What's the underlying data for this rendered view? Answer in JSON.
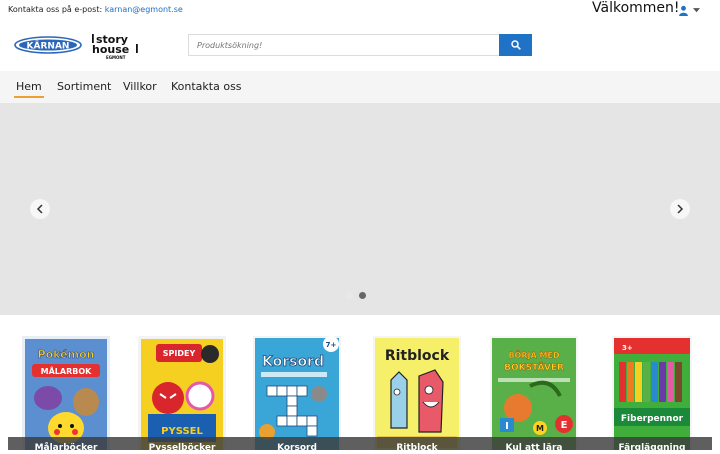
{
  "topbar": {
    "contact_prefix": "Kontakta oss på e-post:",
    "contact_email": "karnan@egmont.se",
    "welcome": "Välkommen!"
  },
  "header": {
    "logo_karnan": "KÄRNAN",
    "logo_story_line1": "story",
    "logo_story_line2": "house",
    "logo_story_sub": "EGMONT",
    "search_placeholder": "Produktsökning!"
  },
  "nav": {
    "items": [
      {
        "label": "Hem",
        "active": true
      },
      {
        "label": "Sortiment",
        "active": false
      },
      {
        "label": "Villkor",
        "active": false
      },
      {
        "label": "Kontakta oss",
        "active": false
      }
    ]
  },
  "hero": {
    "slides": 2,
    "active_slide": 2
  },
  "products": [
    {
      "label": "Målarböcker",
      "cover_title": "MÅLARBOK",
      "cover_brand": "Pokémon"
    },
    {
      "label": "Pysselböcker",
      "cover_title": "PYSSEL",
      "cover_brand": "SPIDEY"
    },
    {
      "label": "Korsord",
      "cover_title": "Korsord",
      "cover_brand": "7+"
    },
    {
      "label": "Ritblock",
      "cover_title": "Ritblock",
      "cover_brand": ""
    },
    {
      "label": "Kul att lära",
      "cover_title": "BÖRJA MED BOKSTÄVER",
      "cover_brand": ""
    },
    {
      "label": "Färgläggning",
      "cover_title": "Fiberpennor",
      "cover_brand": "3+"
    }
  ],
  "colors": {
    "accent": "#1f72c6",
    "nav_underline": "#f0a030",
    "hero_bg": "#e5e5e5"
  }
}
